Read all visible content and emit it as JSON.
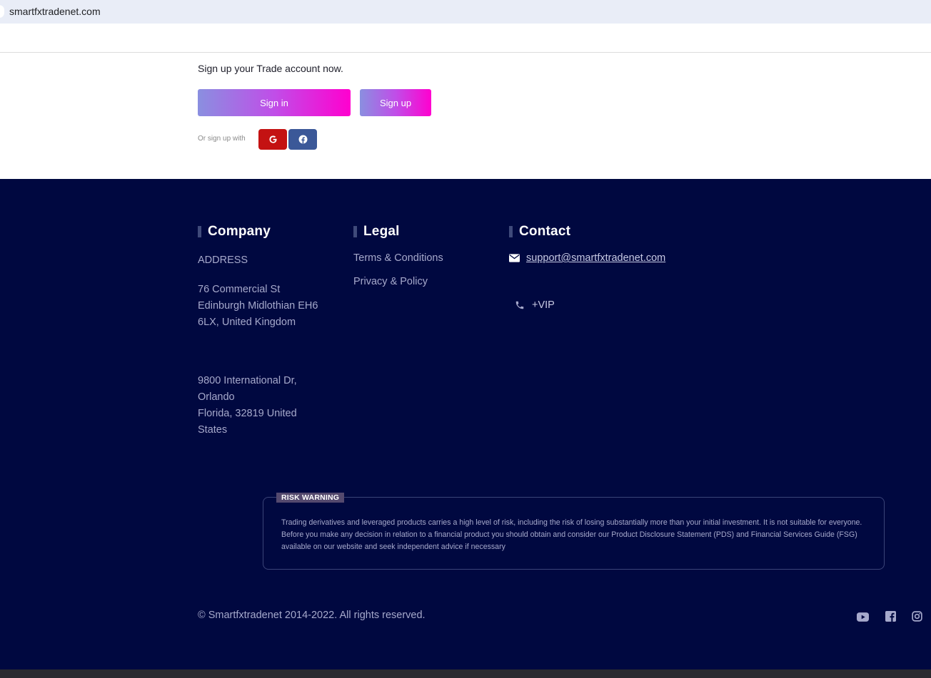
{
  "browser": {
    "url": "smartfxtradenet.com"
  },
  "signup": {
    "tagline": "Sign up your Trade account now.",
    "signin_label": "Sign in",
    "signup_label": "Sign up",
    "or_text": "Or sign up with"
  },
  "footer": {
    "company": {
      "title": "Company",
      "address_label": "ADDRESS",
      "address1": [
        "76 Commercial St",
        "Edinburgh Midlothian EH6",
        "6LX, United Kingdom"
      ],
      "address2": [
        "9800 International Dr,",
        "Orlando",
        "Florida, 32819 United",
        "States"
      ]
    },
    "legal": {
      "title": "Legal",
      "terms": "Terms & Conditions",
      "privacy": "Privacy & Policy"
    },
    "contact": {
      "title": "Contact",
      "email": "support@smartfxtradenet.com",
      "phone": "+VIP"
    },
    "risk": {
      "label": "RISK WARNING",
      "text": "Trading derivatives and leveraged products carries a high level of risk, including the risk of losing substantially more than your initial investment. It is not suitable for everyone. Before you make any decision in relation to a financial product you should obtain and consider our Product Disclosure Statement (PDS) and Financial Services Guide (FSG) available on our website and seek independent advice if necessary"
    },
    "copyright": "© Smartfxtradenet 2014-2022. All rights reserved."
  },
  "colors": {
    "footer_bg": "#000840",
    "google_red": "#c41212",
    "facebook_blue": "#3b5898",
    "gradient_start": "#8a8fe0",
    "gradient_end": "#ff00cf"
  },
  "icons": {
    "google": "google-icon",
    "facebook": "facebook-icon",
    "email": "envelope-icon",
    "phone": "phone-icon",
    "youtube": "youtube-icon",
    "facebook_square": "facebook-square-icon",
    "instagram": "instagram-icon"
  }
}
